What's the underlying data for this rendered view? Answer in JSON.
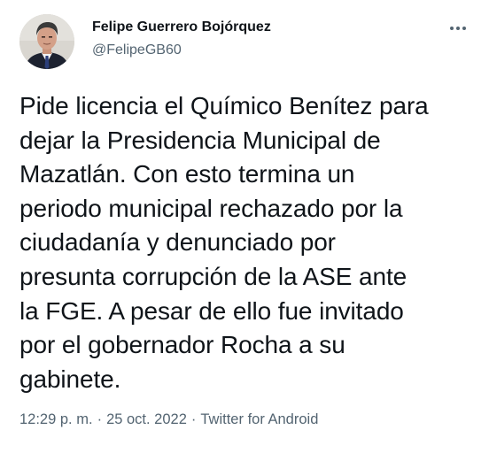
{
  "author": {
    "name": "Felipe Guerrero Bojórquez",
    "handle": "@FelipeGB60",
    "avatar_icon": "profile-photo"
  },
  "more_icon": "more-dots-icon",
  "tweet": {
    "text": "Pide licencia el Químico Benítez para\ndejar la Presidencia Municipal de\nMazatlán. Con esto termina un\nperiodo municipal rechazado por la\nciudadanía y denunciado por\npresunta corrupción de la ASE ante\nla FGE. A pesar de ello  fue invitado\npor el gobernador Rocha a su\ngabinete."
  },
  "meta": {
    "time": "12:29 p. m.",
    "separator": "·",
    "date": "25 oct. 2022",
    "source": "Twitter for Android"
  },
  "colors": {
    "text": "#0f1419",
    "secondary": "#536471",
    "background": "#ffffff"
  }
}
